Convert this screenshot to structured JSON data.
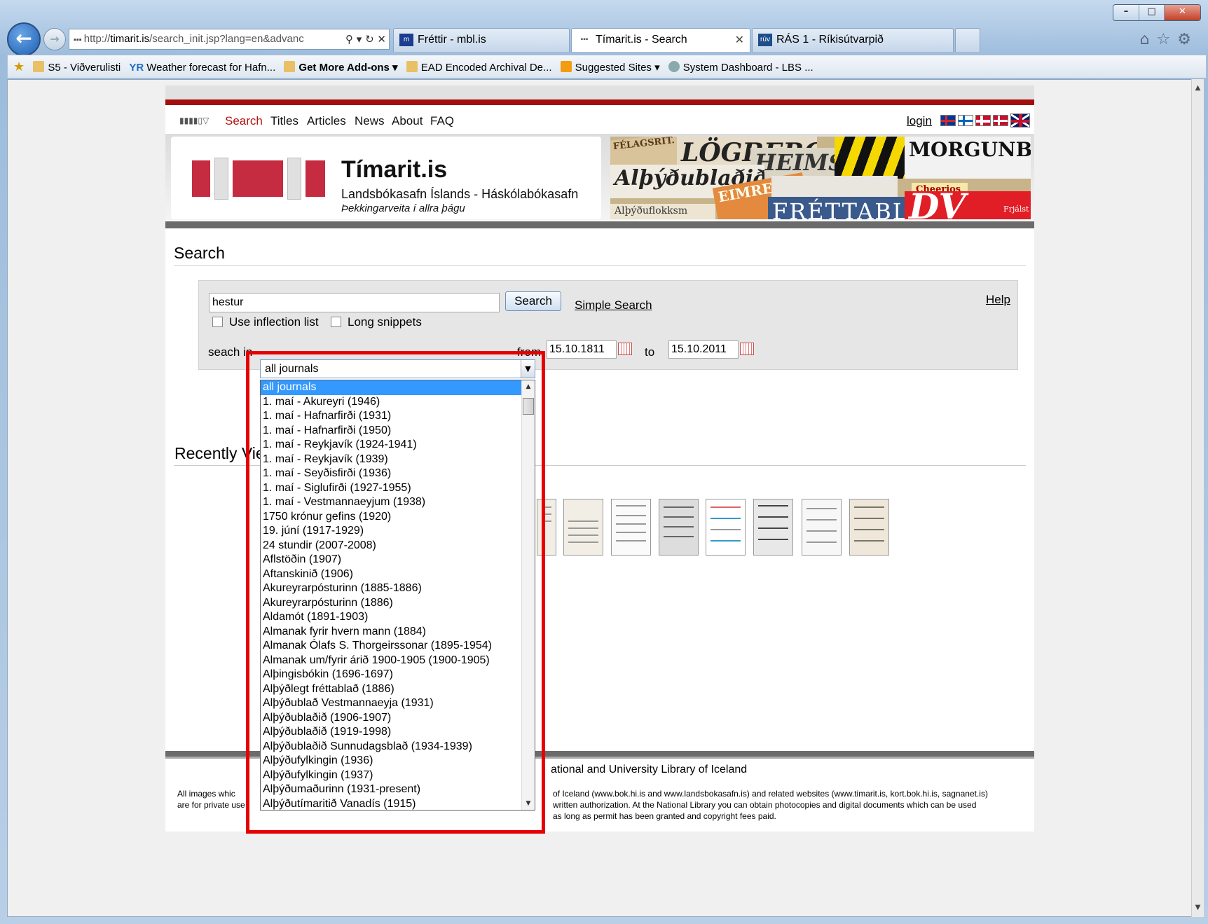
{
  "browser": {
    "window_controls": {
      "minimize": "–",
      "maximize": "□",
      "close": "✕"
    },
    "address": {
      "prefix": "http://",
      "host": "timarit.is",
      "path": "/search_init.jsp?lang=en&advanc"
    },
    "tabs": [
      {
        "label": "Fréttir - mbl.is",
        "icon": "mbl-icon",
        "active": false
      },
      {
        "label": "Tímarit.is - Search",
        "icon": "timarit-icon",
        "active": true
      },
      {
        "label": "RÁS 1 - Ríkisútvarpið",
        "icon": "ruv-icon",
        "active": false
      }
    ],
    "favorites": [
      {
        "label": "S5 - Viðverulisti",
        "icon": "ie-page-icon"
      },
      {
        "label": "Weather forecast for Hafn...",
        "icon": "yr-icon"
      },
      {
        "label": "Get More Add-ons ▾",
        "icon": "ie-page-icon"
      },
      {
        "label": "EAD Encoded Archival De...",
        "icon": "ie-page-icon"
      },
      {
        "label": "Suggested Sites ▾",
        "icon": "suggested-sites-icon"
      },
      {
        "label": "System Dashboard - LBS ...",
        "icon": "dashboard-icon"
      }
    ]
  },
  "site": {
    "menu": [
      "Search",
      "Titles",
      "Articles",
      "News",
      "About",
      "FAQ"
    ],
    "menu_selected": "Search",
    "login": "login",
    "title": "Tímarit.is",
    "subtitle": "Landsbókasafn Íslands - Háskólabókasafn",
    "tagline": "Þekkingarveita í allra þágu",
    "collage_labels": [
      "FÉLAGSRIT.",
      "LÖGBERG",
      "HEIMSKR",
      "MORGUNBLA",
      "Alþýðublaðið",
      "EIMREIÐ",
      "FRÉTTABLA",
      "DV",
      "Alþýðuflokksm",
      "Cheerios",
      "Frjálst"
    ]
  },
  "search": {
    "heading": "Search",
    "query": "hestur",
    "button": "Search",
    "simple_search": "Simple Search",
    "help": "Help",
    "use_inflection": "Use inflection list",
    "long_snippets": "Long snippets",
    "search_in_label": "seach in",
    "selected_journal": "all journals",
    "from_label": "from",
    "from_date": "15.10.1811",
    "to_label": "to",
    "to_date": "15.10.2011"
  },
  "journal_options": [
    "all journals",
    "1. maí - Akureyri (1946)",
    "1. maí - Hafnarfirði (1931)",
    "1. maí - Hafnarfirði (1950)",
    "1. maí - Reykjavík (1924-1941)",
    "1. maí - Reykjavík (1939)",
    "1. maí - Seyðisfirði (1936)",
    "1. maí - Siglufirði (1927-1955)",
    "1. maí - Vestmannaeyjum (1938)",
    "1750 krónur gefins (1920)",
    "19. júní (1917-1929)",
    "24 stundir (2007-2008)",
    "Aflstöðin (1907)",
    "Aftanskinið (1906)",
    "Akureyrarpósturinn (1885-1886)",
    "Akureyrarpósturinn (1886)",
    "Aldamót (1891-1903)",
    "Almanak fyrir hvern mann (1884)",
    "Almanak Ólafs S. Thorgeirssonar (1895-1954)",
    "Almanak um/fyrir árið 1900-1905 (1900-1905)",
    "Alþingisbókin (1696-1697)",
    "Alþýðlegt fréttablað (1886)",
    "Alþýðublað Vestmannaeyja (1931)",
    "Alþýðublaðið (1906-1907)",
    "Alþýðublaðið (1919-1998)",
    "Alþýðublaðið Sunnudagsblað (1934-1939)",
    "Alþýðufylkingin (1936)",
    "Alþýðufylkingin (1937)",
    "Alþýðumaðurinn (1931-present)",
    "Alþýðutímaritið Vanadís (1915)"
  ],
  "recent": {
    "heading": "Recently Vie"
  },
  "footer": {
    "title": "ational and University Library of Iceland",
    "left_1": "All images whic",
    "left_2": "are for private use",
    "right_1": "of Iceland (www.bok.hi.is and www.landsbokasafn.is) and related websites (www.timarit.is, kort.bok.hi.is, sagnanet.is)",
    "right_2": "written authorization. At the National Library you can obtain photocopies and digital documents which can be used",
    "right_3": "as long as permit has been granted and copyright fees paid."
  },
  "colors": {
    "accent_red": "#b41313",
    "highlight_box": "#e60000",
    "list_selection": "#3399ff"
  }
}
